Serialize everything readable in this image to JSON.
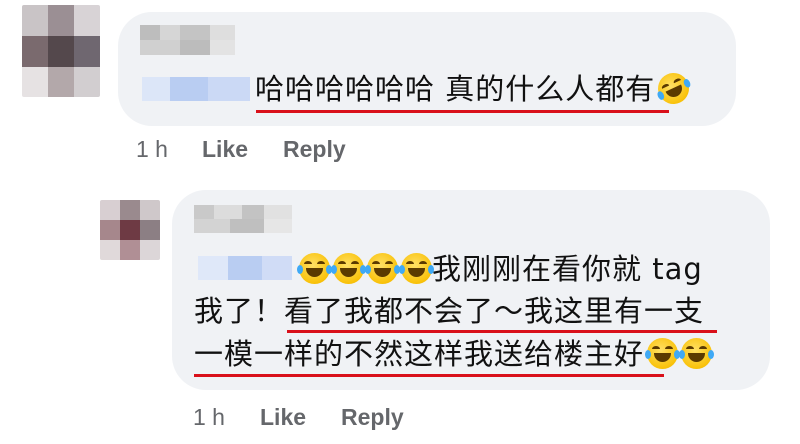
{
  "comment1": {
    "line1": "哈哈哈哈哈哈 真的什么人都有",
    "emoji_icon": "rolling-on-floor-laughing-icon",
    "time": "1 h",
    "like_label": "Like",
    "reply_label": "Reply"
  },
  "reply1": {
    "line1": "我刚刚在看你就 tag",
    "line2_pre": "我了！",
    "line2_underlined": "看了我都不会了～我这里有一支",
    "line3": "一模一样的不然这样我送给楼主好",
    "emoji_icon": "face-with-tears-of-joy-icon",
    "time": "1 h",
    "like_label": "Like",
    "reply_label": "Reply"
  },
  "colors": {
    "bubble": "#f0f2f5",
    "meta_text": "#65676b",
    "underline": "#d9101a",
    "name_blur": "#c8c8c8",
    "tag_blur": "#b9cdf2"
  }
}
